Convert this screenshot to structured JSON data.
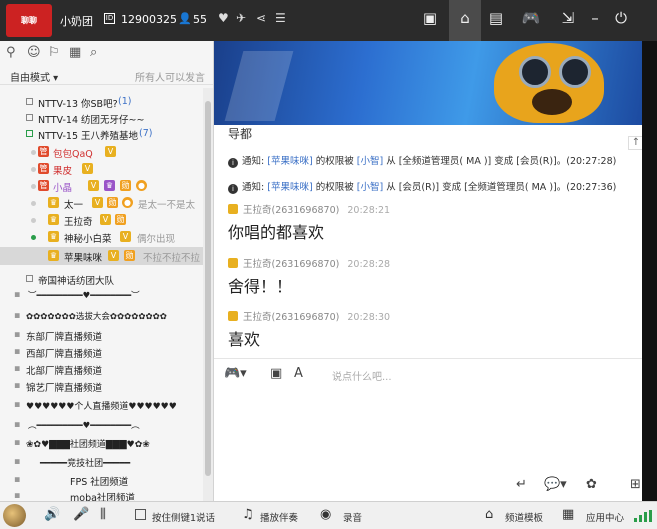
{
  "topbar": {
    "logo_text": "聊聊",
    "name": "小奶团",
    "channel_id": "12900325",
    "online_count": "55",
    "icons": [
      "heart-icon",
      "plane-icon",
      "share-icon",
      "menu-icon"
    ],
    "right_icons": [
      "video-icon",
      "home-icon",
      "list-icon",
      "gamepad-icon",
      "minimize-to-tray-icon",
      "minimize-icon",
      "power-icon"
    ]
  },
  "left_panel": {
    "mode_label": "自由模式",
    "mode_hint": "所有人可以发言",
    "tree": [
      {
        "text": "NTTV-13 你SB吧?",
        "count": "(1)"
      },
      {
        "text": "NTTV-14 纺团无牙仔~~"
      },
      {
        "text": "NTTV-15 王八养殖基地",
        "count": "(7)"
      },
      {
        "text": "包包QaQ"
      },
      {
        "text": "果皮"
      },
      {
        "text": "小晶"
      },
      {
        "text": "太一",
        "note": "是太一不是太"
      },
      {
        "text": "王拉奇"
      },
      {
        "text": "神秘小白菜",
        "note": "偶尔出现"
      },
      {
        "text": "苹果味咪",
        "note": "不拉不拉不拉"
      },
      {
        "text": "帝国神话纺团大队"
      },
      {
        "text": "︶━━━━━━━━━♥━━━━━━━━︶"
      },
      {
        "text": "✿✿✿✿✿✿✿选拔大会✿✿✿✿✿✿✿✿"
      },
      {
        "text": "东部厂牌直播频道"
      },
      {
        "text": "西部厂牌直播频道"
      },
      {
        "text": "北部厂牌直播频道"
      },
      {
        "text": "锦艺厂牌直播频道"
      },
      {
        "text": "♥♥♥♥♥♥个人直播频道♥♥♥♥♥♥"
      },
      {
        "text": "︵━━━━━━━━━♥━━━━━━━━︵"
      },
      {
        "text": "❀✿♥▇▇▇社团频道▇▇▇♥✿❀"
      },
      {
        "text": "━━━━━竞技社团━━━━━"
      },
      {
        "text": "FPS 社团频道"
      },
      {
        "text": "moba社团频道"
      }
    ]
  },
  "chat": {
    "channel_name": "导都",
    "notices": [
      {
        "prefix": "通知:",
        "user": "[苹果味咪]",
        "mid1": "的权限被",
        "admin": "[小智]",
        "mid2": "从 [全频道管理员( MA )] 变成 [会员(R)]。",
        "time": "(20:27:28)"
      },
      {
        "prefix": "通知:",
        "user": "[苹果味咪]",
        "mid1": "的权限被",
        "admin": "[小智]",
        "mid2": "从 [会员(R)] 变成 [全频道管理员( MA )]。",
        "time": "(20:27:36)"
      }
    ],
    "messages": [
      {
        "sender": "王拉奇(2631696870)",
        "time": "20:28:21",
        "text": "你唱的都喜欢"
      },
      {
        "sender": "王拉奇(2631696870)",
        "time": "20:28:28",
        "text": "舍得！！"
      },
      {
        "sender": "王拉奇(2631696870)",
        "time": "20:28:30",
        "text": "喜欢"
      }
    ],
    "input_placeholder": "说点什么吧..."
  },
  "bottombar": {
    "ptt_label": "按住侧键1说话",
    "accompany_label": "播放伴奏",
    "record_label": "录音",
    "template_label": "频道模板",
    "app_center_label": "应用中心"
  }
}
